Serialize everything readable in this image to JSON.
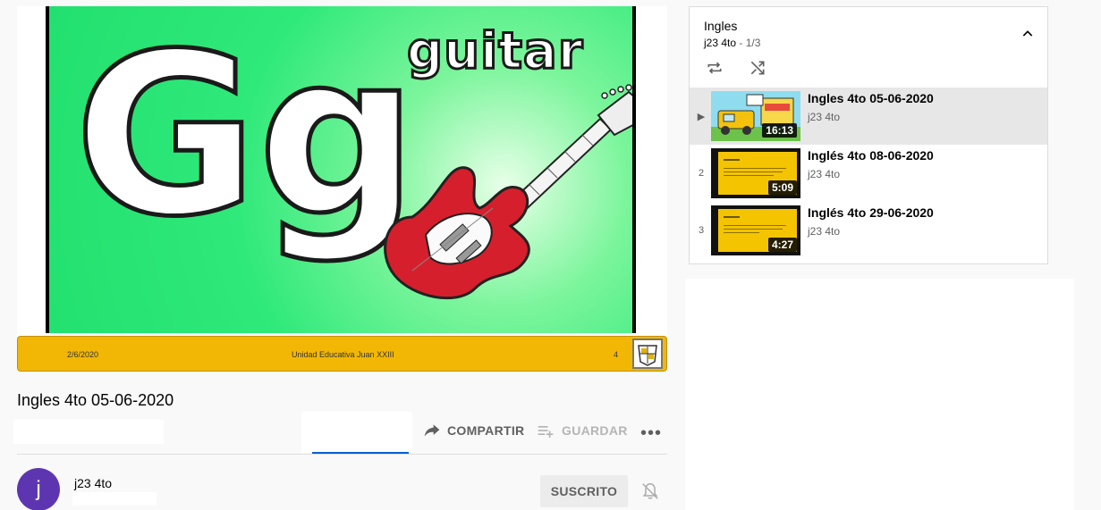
{
  "slide": {
    "word": "guitar",
    "letters": "Gg",
    "footer_date": "2/6/2020",
    "footer_school": "Unidad Educativa Juan XXIII",
    "footer_page": "4"
  },
  "video": {
    "title": "Ingles 4to 05-06-2020",
    "share_label": "COMPARTIR",
    "save_label": "GUARDAR",
    "more_label": "•••"
  },
  "channel": {
    "avatar_letter": "j",
    "name": "j23 4to",
    "subscribed_label": "SUSCRITO"
  },
  "playlist": {
    "title": "Ingles",
    "channel": "j23 4to",
    "position": " - 1/3",
    "items": [
      {
        "index": "▶",
        "title": "Ingles 4to 05-06-2020",
        "channel": "j23 4to",
        "duration": "16:13",
        "active": true
      },
      {
        "index": "2",
        "title": "Inglés 4to 08-06-2020",
        "channel": "j23 4to",
        "duration": "5:09"
      },
      {
        "index": "3",
        "title": "Inglés 4to 29-06-2020",
        "channel": "j23 4to",
        "duration": "4:27"
      }
    ]
  },
  "colors": {
    "accent": "#065fd4",
    "slide_green": "#22e06f",
    "footer_yellow": "#f2b705",
    "avatar": "#5e35b1"
  },
  "icons": [
    "share-icon",
    "playlist-add-icon",
    "more-icon",
    "bell-off-icon",
    "chevron-up-icon",
    "loop-icon",
    "shuffle-icon",
    "play-indicator-icon"
  ]
}
